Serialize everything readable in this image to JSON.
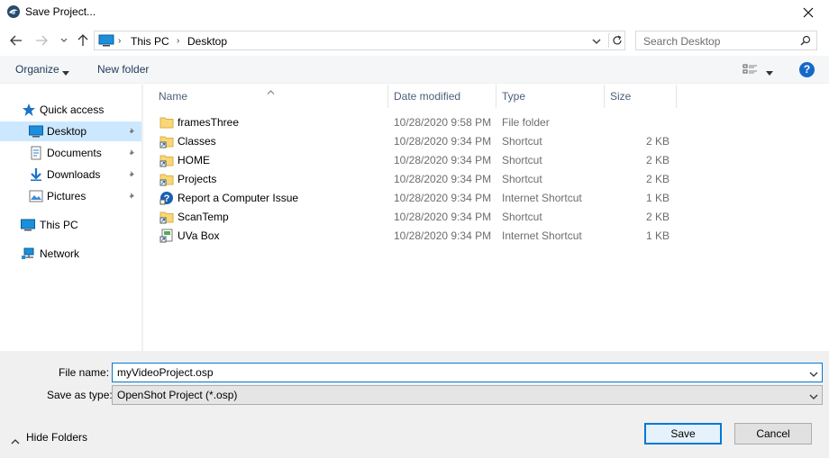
{
  "window": {
    "title": "Save Project..."
  },
  "address": {
    "crumbs": [
      "This PC",
      "Desktop"
    ],
    "search_placeholder": "Search Desktop"
  },
  "toolbar": {
    "organize": "Organize",
    "new_folder": "New folder"
  },
  "sidebar": {
    "items": [
      {
        "label": "Quick access",
        "icon": "star-icon"
      },
      {
        "label": "Desktop",
        "icon": "desktop-icon",
        "selected": true,
        "pinned": true
      },
      {
        "label": "Documents",
        "icon": "documents-icon",
        "pinned": true
      },
      {
        "label": "Downloads",
        "icon": "download-icon",
        "pinned": true
      },
      {
        "label": "Pictures",
        "icon": "pictures-icon",
        "pinned": true
      },
      {
        "label": "This PC",
        "icon": "computer-icon"
      },
      {
        "label": "Network",
        "icon": "network-icon"
      }
    ]
  },
  "columns": {
    "name": "Name",
    "date": "Date modified",
    "type": "Type",
    "size": "Size"
  },
  "files": [
    {
      "name": "framesThree",
      "date": "10/28/2020 9:58 PM",
      "type": "File folder",
      "size": "",
      "icon": "folder-icon"
    },
    {
      "name": "Classes",
      "date": "10/28/2020 9:34 PM",
      "type": "Shortcut",
      "size": "2 KB",
      "icon": "folder-shortcut-icon"
    },
    {
      "name": "HOME",
      "date": "10/28/2020 9:34 PM",
      "type": "Shortcut",
      "size": "2 KB",
      "icon": "folder-shortcut-icon"
    },
    {
      "name": "Projects",
      "date": "10/28/2020 9:34 PM",
      "type": "Shortcut",
      "size": "2 KB",
      "icon": "folder-shortcut-icon"
    },
    {
      "name": "Report a Computer Issue",
      "date": "10/28/2020 9:34 PM",
      "type": "Internet Shortcut",
      "size": "1 KB",
      "icon": "help-shortcut-icon"
    },
    {
      "name": "ScanTemp",
      "date": "10/28/2020 9:34 PM",
      "type": "Shortcut",
      "size": "2 KB",
      "icon": "folder-shortcut-icon"
    },
    {
      "name": "UVa Box",
      "date": "10/28/2020 9:34 PM",
      "type": "Internet Shortcut",
      "size": "1 KB",
      "icon": "web-shortcut-icon"
    }
  ],
  "form": {
    "file_name_label": "File name:",
    "file_name_value": "myVideoProject.osp",
    "save_type_label": "Save as type:",
    "save_type_value": "OpenShot Project (*.osp)",
    "hide_folders": "Hide Folders",
    "save_button": "Save",
    "cancel_button": "Cancel"
  },
  "colors": {
    "accent": "#0078d7",
    "selected_bg": "#cce8ff",
    "link_text": "#1e395b"
  }
}
